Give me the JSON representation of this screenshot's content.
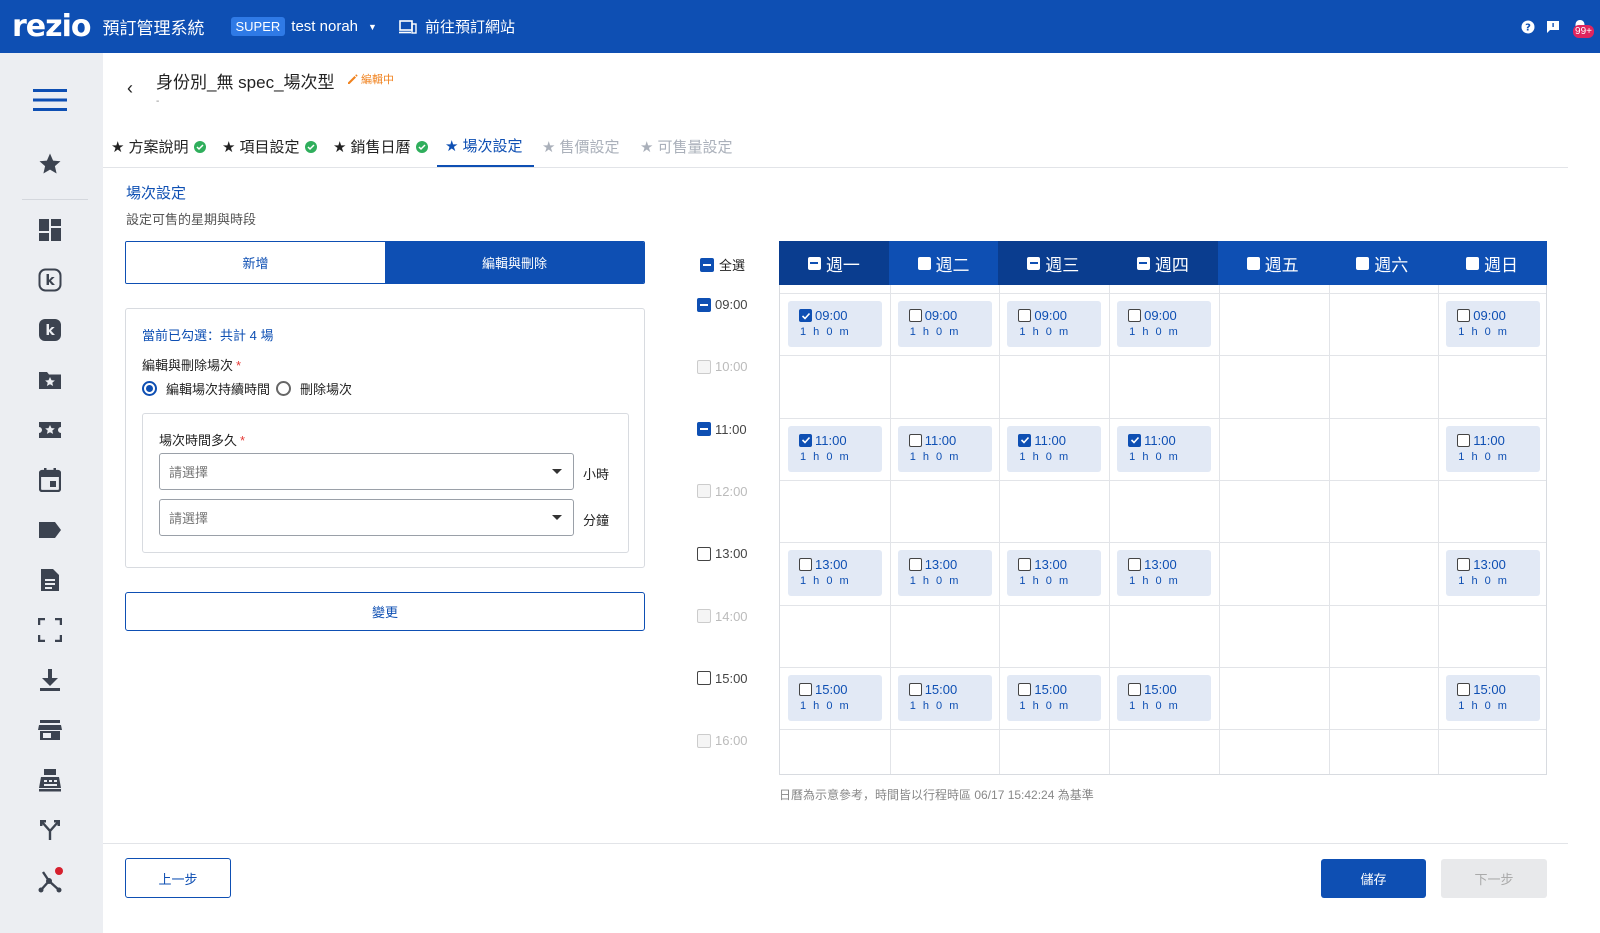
{
  "header": {
    "logo": "rezio",
    "app_title": "預訂管理系統",
    "role_badge": "SUPER",
    "user_name": "test norah",
    "site_link": "前往預訂網站",
    "notification_count": "99+"
  },
  "sidebar": {
    "icons": [
      "menu-icon",
      "star-icon",
      "dashboard-icon",
      "k-outline-icon",
      "k-filled-icon",
      "folder-star-icon",
      "ticket-star-icon",
      "calendar-icon",
      "tag-icon",
      "document-icon",
      "scan-frame-icon",
      "download-icon",
      "store-icon",
      "printer-icon",
      "fork-icon",
      "share-network-icon"
    ]
  },
  "page": {
    "title": "身份別_無 spec_場次型",
    "editing_tag": "編輯中",
    "subtitle": "-"
  },
  "tabs": [
    {
      "label": "方案說明",
      "state": "done"
    },
    {
      "label": "項目設定",
      "state": "done"
    },
    {
      "label": "銷售日曆",
      "state": "done"
    },
    {
      "label": "場次設定",
      "state": "active"
    },
    {
      "label": "售價設定",
      "state": "disabled"
    },
    {
      "label": "可售量設定",
      "state": "disabled"
    }
  ],
  "section": {
    "title": "場次設定",
    "subtitle": "設定可售的星期與時段"
  },
  "segment": {
    "add_label": "新增",
    "edit_label": "編輯與刪除"
  },
  "panel": {
    "selection_summary": "當前已勾選：共計 4 場",
    "edit_delete_label": "編輯與刪除場次",
    "radio_edit_duration": "編輯場次持續時間",
    "radio_delete": "刪除場次",
    "duration_label": "場次時間多久",
    "hour_placeholder": "請選擇",
    "hour_unit": "小時",
    "minute_placeholder": "請選擇",
    "minute_unit": "分鐘",
    "change_button": "變更"
  },
  "schedule": {
    "select_all_label": "全選",
    "days": [
      "週一",
      "週二",
      "週三",
      "週四",
      "週五",
      "週六",
      "週日"
    ],
    "day_states": [
      "partial",
      "empty",
      "partial",
      "partial",
      "empty",
      "empty",
      "empty"
    ],
    "times": [
      "09:00",
      "10:00",
      "11:00",
      "12:00",
      "13:00",
      "14:00",
      "15:00",
      "16:00"
    ],
    "time_states": [
      "partial",
      "disabled",
      "partial",
      "disabled",
      "empty",
      "disabled",
      "empty",
      "disabled"
    ],
    "slot_duration": "1 h 0 m",
    "slots": [
      {
        "day": 0,
        "time": "09:00",
        "checked": true
      },
      {
        "day": 1,
        "time": "09:00",
        "checked": false
      },
      {
        "day": 2,
        "time": "09:00",
        "checked": false
      },
      {
        "day": 3,
        "time": "09:00",
        "checked": false
      },
      {
        "day": 6,
        "time": "09:00",
        "checked": false
      },
      {
        "day": 0,
        "time": "11:00",
        "checked": true
      },
      {
        "day": 1,
        "time": "11:00",
        "checked": false
      },
      {
        "day": 2,
        "time": "11:00",
        "checked": true
      },
      {
        "day": 3,
        "time": "11:00",
        "checked": true
      },
      {
        "day": 6,
        "time": "11:00",
        "checked": false
      },
      {
        "day": 0,
        "time": "13:00",
        "checked": false
      },
      {
        "day": 1,
        "time": "13:00",
        "checked": false
      },
      {
        "day": 2,
        "time": "13:00",
        "checked": false
      },
      {
        "day": 3,
        "time": "13:00",
        "checked": false
      },
      {
        "day": 6,
        "time": "13:00",
        "checked": false
      },
      {
        "day": 0,
        "time": "15:00",
        "checked": false
      },
      {
        "day": 1,
        "time": "15:00",
        "checked": false
      },
      {
        "day": 2,
        "time": "15:00",
        "checked": false
      },
      {
        "day": 3,
        "time": "15:00",
        "checked": false
      },
      {
        "day": 6,
        "time": "15:00",
        "checked": false
      }
    ],
    "footnote": "日曆為示意參考，時間皆以行程時區 06/17 15:42:24 為基準"
  },
  "footer": {
    "prev_button": "上一步",
    "save_button": "儲存",
    "next_button": "下一步"
  },
  "colors": {
    "brand_blue": "#0e4fb3",
    "header_dark": "#0a3d8f",
    "slot_bg": "#e2e9f5",
    "success_green": "#2fae5c",
    "editing_orange": "#f0821e",
    "required_red": "#e53935"
  }
}
